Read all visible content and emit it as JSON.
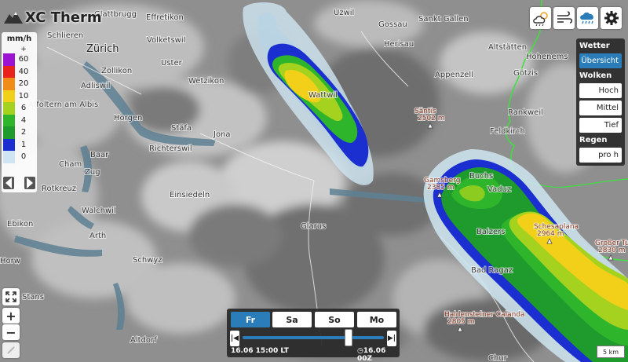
{
  "app": {
    "title": "XC Therm"
  },
  "legend": {
    "unit": "mm/h",
    "plus": "+",
    "levels": [
      {
        "label": "60",
        "color": "#9a14d2"
      },
      {
        "label": "40",
        "color": "#e8231b"
      },
      {
        "label": "20",
        "color": "#f08c18"
      },
      {
        "label": "10",
        "color": "#f2d01a"
      },
      {
        "label": "6",
        "color": "#a4d21f"
      },
      {
        "label": "4",
        "color": "#2fb52c"
      },
      {
        "label": "2",
        "color": "#1f9a2c"
      },
      {
        "label": "1",
        "color": "#1b2fd0"
      },
      {
        "label": "0",
        "color": "#cfe6f2"
      }
    ]
  },
  "map": {
    "places": [
      {
        "name": "Glattbrugg",
        "big": false
      },
      {
        "name": "Effretikon",
        "big": false
      },
      {
        "name": "Uzwil",
        "big": false
      },
      {
        "name": "Gossau",
        "big": false
      },
      {
        "name": "Sankt Gallen",
        "big": false
      },
      {
        "name": "Schlieren",
        "big": false
      },
      {
        "name": "Zürich",
        "big": true
      },
      {
        "name": "Volketswil",
        "big": false
      },
      {
        "name": "Herisau",
        "big": false
      },
      {
        "name": "Altstätten",
        "big": false
      },
      {
        "name": "Hohenems",
        "big": false
      },
      {
        "name": "Zollikon",
        "big": false
      },
      {
        "name": "Uster",
        "big": false
      },
      {
        "name": "Adliswil",
        "big": false
      },
      {
        "name": "Appenzell",
        "big": false
      },
      {
        "name": "Götzis",
        "big": false
      },
      {
        "name": "Wetzikon",
        "big": false
      },
      {
        "name": "Wattwil",
        "big": false
      },
      {
        "name": "Affoltern am Albis",
        "big": false
      },
      {
        "name": "Horgen",
        "big": false
      },
      {
        "name": "Rankweil",
        "big": false
      },
      {
        "name": "Stäfa",
        "big": false
      },
      {
        "name": "Jona",
        "big": false
      },
      {
        "name": "Feldkirch",
        "big": false
      },
      {
        "name": "Richterswil",
        "big": false
      },
      {
        "name": "Baar",
        "big": false
      },
      {
        "name": "Cham",
        "big": false
      },
      {
        "name": "Zug",
        "big": false
      },
      {
        "name": "Buchs",
        "big": false
      },
      {
        "name": "Vaduz",
        "big": false
      },
      {
        "name": "Rotkreuz",
        "big": false
      },
      {
        "name": "Einsiedeln",
        "big": false
      },
      {
        "name": "Walchwil",
        "big": false
      },
      {
        "name": "Ebikon",
        "big": false
      },
      {
        "name": "Glarus",
        "big": false
      },
      {
        "name": "Balzers",
        "big": false
      },
      {
        "name": "Arth",
        "big": false
      },
      {
        "name": "Schwyz",
        "big": false
      },
      {
        "name": "Horw",
        "big": false
      },
      {
        "name": "Bad Ragaz",
        "big": false
      },
      {
        "name": "Stans",
        "big": false
      },
      {
        "name": "Altdorf",
        "big": false
      },
      {
        "name": "Chur",
        "big": false
      }
    ],
    "peaks": [
      {
        "name": "Säntis",
        "elev": "2502 m"
      },
      {
        "name": "Gamsberg",
        "elev": "2385 m"
      },
      {
        "name": "Schesaplana",
        "elev": "2964 m"
      },
      {
        "name": "Großer Turm",
        "elev": "2830 m"
      },
      {
        "name": "Haldensteiner Calanda",
        "elev": "2805 m"
      }
    ]
  },
  "icons": {
    "cloud": "cloud-sun-icon",
    "wind": "wind-icon",
    "rain": "rain-cloud-icon",
    "settings": "gear-icon"
  },
  "panel": {
    "wetter_heading": "Wetter",
    "overview_button": "Übersicht",
    "clouds_heading": "Wolken",
    "high_button": "Hoch",
    "mid_button": "Mittel",
    "low_button": "Tief",
    "rain_heading": "Regen",
    "per_hour_button": "pro h"
  },
  "timebar": {
    "days": [
      "Fr",
      "Sa",
      "So",
      "Mo"
    ],
    "active_day": "Fr",
    "current_time": "16.06 15:00 LT",
    "run_time": "16.06 00Z",
    "slider_fraction": 0.75
  },
  "zoom": {
    "plus": "+",
    "minus": "−"
  },
  "scale": {
    "label": "5 km"
  },
  "colors": {
    "accent": "#2a7db8",
    "panel": "#282828"
  }
}
